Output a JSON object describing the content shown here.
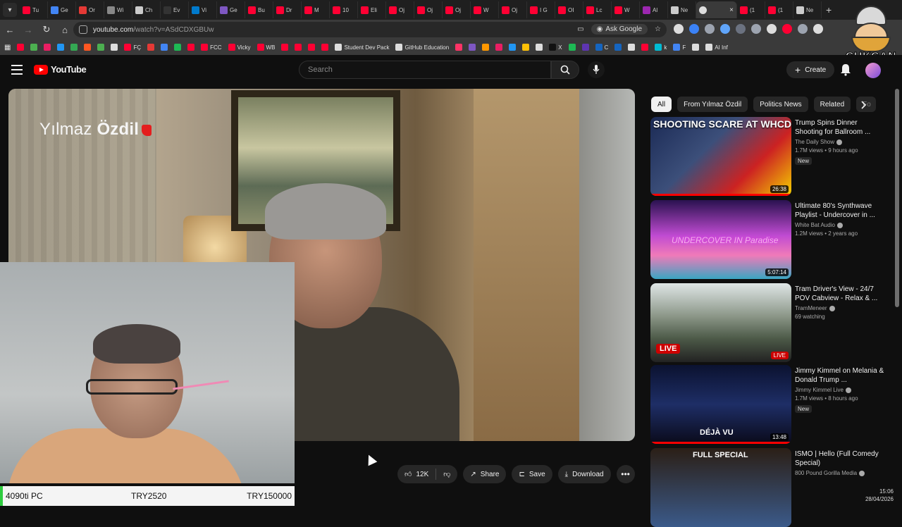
{
  "browser": {
    "tabs": [
      {
        "label": "Tu",
        "color": "#ff0033"
      },
      {
        "label": "Ge",
        "color": "#4285f4"
      },
      {
        "label": "Or",
        "color": "#e53935"
      },
      {
        "label": "Wi",
        "color": "#888888"
      },
      {
        "label": "Ch",
        "color": "#cccccc"
      },
      {
        "label": "Ev",
        "color": "#333333"
      },
      {
        "label": "Vi",
        "color": "#007acc"
      },
      {
        "label": "Ge",
        "color": "#7e57c2"
      },
      {
        "label": "Bu",
        "color": "#ff0033"
      },
      {
        "label": "Dr",
        "color": "#ff0033"
      },
      {
        "label": "M",
        "color": "#ff0033"
      },
      {
        "label": "10",
        "color": "#ff0033"
      },
      {
        "label": "Eli",
        "color": "#ff0033"
      },
      {
        "label": "Oj",
        "color": "#ff0033"
      },
      {
        "label": "Oj",
        "color": "#ff0033"
      },
      {
        "label": "Oj",
        "color": "#ff0033"
      },
      {
        "label": "W",
        "color": "#ff0033"
      },
      {
        "label": "Oj",
        "color": "#ff0033"
      },
      {
        "label": "I G",
        "color": "#ff0033"
      },
      {
        "label": "OI",
        "color": "#ff0033"
      },
      {
        "label": "Lc",
        "color": "#ff0033"
      },
      {
        "label": "W",
        "color": "#ff0033"
      },
      {
        "label": "Al",
        "color": "#9c27b0"
      },
      {
        "label": "Ne",
        "color": "#cccccc"
      }
    ],
    "active_tab": {
      "label": "",
      "close": "×"
    },
    "trailing_tabs": [
      {
        "label": "(1",
        "color": "#ff0033"
      },
      {
        "label": "(1",
        "color": "#ff0033"
      },
      {
        "label": "Ne",
        "color": "#cccccc"
      }
    ],
    "new_tab": "+",
    "url_host": "youtube.com",
    "url_path": "/watch?v=ASdCDXGBUw",
    "ask_google": "Ask Google",
    "bookmarks": [
      {
        "label": "",
        "color": "#ff0033"
      },
      {
        "label": "",
        "color": "#4caf50"
      },
      {
        "label": "",
        "color": "#e91e63"
      },
      {
        "label": "",
        "color": "#2196f3"
      },
      {
        "label": "",
        "color": "#34a853"
      },
      {
        "label": "",
        "color": "#ff5722"
      },
      {
        "label": "",
        "color": "#4caf50"
      },
      {
        "label": "",
        "color": "#dddddd"
      },
      {
        "label": "FÇ",
        "color": "#ff0033"
      },
      {
        "label": "",
        "color": "#e53935"
      },
      {
        "label": "",
        "color": "#4285f4"
      },
      {
        "label": "",
        "color": "#1db954"
      },
      {
        "label": "",
        "color": "#ff0033"
      },
      {
        "label": "FCC",
        "color": "#ff0033"
      },
      {
        "label": "Vicky",
        "color": "#ff0033"
      },
      {
        "label": "WB",
        "color": "#ff0033"
      },
      {
        "label": "",
        "color": "#ff0033"
      },
      {
        "label": "",
        "color": "#ff0033"
      },
      {
        "label": "",
        "color": "#ff0033"
      },
      {
        "label": "",
        "color": "#ff0033"
      },
      {
        "label": "Student Dev Pack",
        "color": "#dddddd"
      },
      {
        "label": "GitHub Education",
        "color": "#dddddd"
      },
      {
        "label": "",
        "color": "#ff3366"
      },
      {
        "label": "",
        "color": "#7e57c2"
      },
      {
        "label": "",
        "color": "#ff9800"
      },
      {
        "label": "",
        "color": "#e91e63"
      },
      {
        "label": "",
        "color": "#2196f3"
      },
      {
        "label": "",
        "color": "#ffc107"
      },
      {
        "label": "",
        "color": "#dddddd"
      },
      {
        "label": "X",
        "color": "#111111"
      },
      {
        "label": "",
        "color": "#1db954"
      },
      {
        "label": "",
        "color": "#5e35b1"
      },
      {
        "label": "C",
        "color": "#1565c0"
      },
      {
        "label": "",
        "color": "#1565c0"
      },
      {
        "label": "",
        "color": "#dddddd"
      },
      {
        "label": "",
        "color": "#ff0033"
      },
      {
        "label": "k",
        "color": "#00bcd4"
      },
      {
        "label": "F",
        "color": "#4285f4"
      },
      {
        "label": "",
        "color": "#dddddd"
      },
      {
        "label": "AI Inf",
        "color": "#dddddd"
      }
    ]
  },
  "youtube": {
    "logo_text": "YouTube",
    "search_placeholder": "Search",
    "create_label": "Create"
  },
  "video": {
    "brand_first": "Yılmaz",
    "brand_last": "Özdil",
    "likes": "12K",
    "share": "Share",
    "save": "Save",
    "download": "Download"
  },
  "stats_bar": {
    "name": "4090ti PC",
    "value1": "TRY2520",
    "value2": "TRY150000",
    "accent": "#2ecc40"
  },
  "clock": {
    "time": "15:06",
    "date": "28/04/2026"
  },
  "sidebar": {
    "chips": [
      "All",
      "From Yılmaz Özdil",
      "Politics News",
      "Related",
      "Fo"
    ],
    "recommendations": [
      {
        "title": "Trump Spins Dinner Shooting for Ballroom ...",
        "channel": "The Daily Show",
        "stats": "1.7M views • 9 hours ago",
        "badge": "New",
        "duration": "26:38",
        "overlay": "SHOOTING SCARE AT WHCD"
      },
      {
        "title": "Ultimate 80's Synthwave Playlist - Undercover in ...",
        "channel": "White Bat Audio",
        "stats": "1.2M views • 2 years ago",
        "badge": "",
        "duration": "5:07:14",
        "overlay": "UNDERCOVER IN Paradise"
      },
      {
        "title": "Tram Driver's View - 24/7 POV Cabview - Relax & ...",
        "channel": "TramMeneer",
        "stats": "69 watching",
        "badge": "",
        "duration": "LIVE",
        "overlay": "LIVE"
      },
      {
        "title": "Jimmy Kimmel on Melania & Donald Trump ...",
        "channel": "Jimmy Kimmel Live",
        "stats": "1.7M views • 8 hours ago",
        "badge": "New",
        "duration": "13:48",
        "overlay": "DÉJÀ VU"
      },
      {
        "title": "ISMO | Hello (Full Comedy Special)",
        "channel": "800 Pound Gorilla Media",
        "stats": "",
        "badge": "",
        "duration": "",
        "overlay": "FULL SPECIAL"
      }
    ]
  },
  "mascot": {
    "name": "CUKCAN"
  }
}
